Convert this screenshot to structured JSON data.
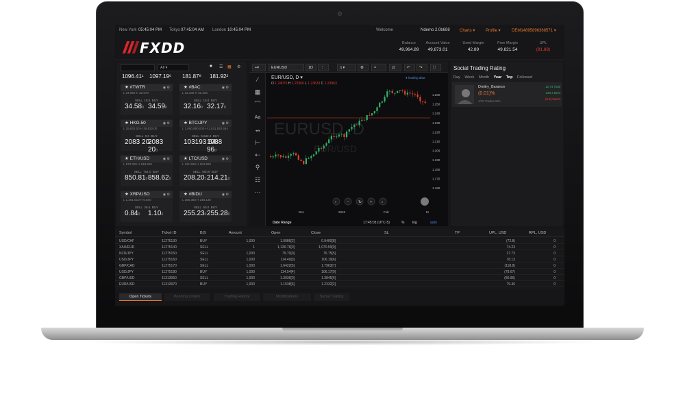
{
  "topbar": {
    "cities": [
      "New York",
      "Tokyo",
      "London"
    ],
    "times": [
      "05:45:04 PM",
      "07:45:04 AM",
      "10:45:04 PM"
    ],
    "welcome": "Welcome",
    "user": "Ndemo 2.0b688",
    "charts": "Charts ▾",
    "profile": "Profile ▾",
    "account": "DEM14895896368571 ▾"
  },
  "brand": {
    "logo": "FXDD"
  },
  "account_stats": [
    {
      "label": "Balance",
      "value": "49,964.89"
    },
    {
      "label": "Account Value",
      "value": "49,873.01"
    },
    {
      "label": "Used Margin",
      "value": "42.89"
    },
    {
      "label": "Free Margin",
      "value": "49,821.54"
    },
    {
      "label": "UPL",
      "value": "(91.88)"
    }
  ],
  "watchlist": {
    "filter": "All ▾",
    "top_row": [
      "1096.41¹",
      "1097.19⁶",
      "181.87⁸",
      "181.92²"
    ],
    "tiles": [
      {
        "symbol": "#TWTR",
        "low": "L 34.950",
        "high": "H 32.570",
        "sell_spread": "SELL",
        "spread": "10.0",
        "buy": "BUY",
        "sell_px": "34.58",
        "sell_sup": "0",
        "buy_px": "34.59",
        "buy_sup": "0"
      },
      {
        "symbol": "#BAC",
        "low": "L 32.230",
        "high": "H 32.330",
        "sell_spread": "SELL",
        "spread": "10.0",
        "buy": "BUY",
        "sell_px": "32.16",
        "sell_sup": "0",
        "buy_px": "32.17",
        "buy_sup": "0"
      },
      {
        "symbol": "HKG.50",
        "low": "L 29,832.00",
        "high": "H 29,832.00",
        "sell_spread": "SELL",
        "spread": "0.0",
        "buy": "BUY",
        "sell_px": "2083 20",
        "sell_sup": "0",
        "buy_px": "2083 20",
        "buy_sup": "0"
      },
      {
        "symbol": "BTC/JPY",
        "low": "L 1,060,950.000",
        "high": "H 1,031,933.644",
        "sell_spread": "SELL",
        "spread": "5,542.4",
        "buy": "BUY",
        "sell_px": "103193 64",
        "sell_sup": "0",
        "buy_px": "1088 96",
        "buy_sup": "0"
      },
      {
        "symbol": "ETH/USD",
        "low": "L 873.000",
        "high": "H 948.520",
        "sell_spread": "SELL",
        "spread": "701.0",
        "buy": "BUY",
        "sell_px": "850.81",
        "sell_sup": "0",
        "buy_px": "858.62",
        "buy_sup": "0"
      },
      {
        "symbol": "LTC/USD",
        "low": "L 221.500",
        "high": "H 204.800",
        "sell_spread": "SELL",
        "spread": "600.9",
        "buy": "BUY",
        "sell_px": "208.20",
        "sell_sup": "1",
        "buy_px": "214.21",
        "buy_sup": "0"
      },
      {
        "symbol": "XRP/USD",
        "low": "L 1,301.510",
        "high": "H 0.840",
        "sell_spread": "SELL",
        "spread": "26.6",
        "buy": "BUY",
        "sell_px": "0.84",
        "sell_sup": "0",
        "buy_px": "1.10",
        "buy_sup": "6"
      },
      {
        "symbol": "#BIDU",
        "low": "L 256.350",
        "high": "H 248.130",
        "sell_spread": "SELL",
        "spread": "50.0",
        "buy": "BUY",
        "sell_px": "255.23",
        "sell_sup": "0",
        "buy_px": "255.28",
        "buy_sup": "0"
      }
    ]
  },
  "chart": {
    "symbol_box": "EURUSD",
    "interval": "1D",
    "title": "EUR/USD, D ▾",
    "ohlc": {
      "o": "1.24075",
      "h": "1.25366",
      "l": "1.23633",
      "c": "1.23963"
    },
    "leading": "● leading data",
    "watermark": "EURUSD, D",
    "watermark_sub": "EUR/USD",
    "x_ticks": [
      "Dec",
      "2018",
      "Feb",
      "M"
    ],
    "y_ticks": [
      "1.260",
      "1.250",
      "1.240",
      "1.230",
      "1.220",
      "1.210",
      "1.200",
      "1.190",
      "1.180",
      "1.170",
      "1.160"
    ],
    "price_labels": [
      "1.25",
      "1.24",
      "1.23"
    ],
    "footer": {
      "range": "Date Range",
      "time": "17:45:03 (UTC-5)",
      "pct": "%",
      "log": "log",
      "auto": "auto"
    },
    "colors": {
      "up": "#2fb36a",
      "down": "#e2412e",
      "line": "#e2412e"
    }
  },
  "social": {
    "title": "Social Trading Rating",
    "tabs": [
      "Day",
      "Week",
      "Month",
      "Year",
      "Top",
      "Followed"
    ],
    "active_tab": "Year",
    "trader": {
      "name": "Dmitry_Baranov",
      "pct": "(0.01)%",
      "trades": "1/15 Trades Win",
      "r1": "12.74 Total",
      "r2": "128.4 Best",
      "r3": "(5.8) Worst"
    }
  },
  "table": {
    "headers": [
      "Symbol",
      "Ticket ID",
      "B|S",
      "Amount",
      "Open",
      "Close",
      "SL",
      "TP",
      "UPL, USD",
      "RPL, USD"
    ],
    "rows": [
      [
        "USD/CHF",
        "11275130",
        "BUY",
        "1,000",
        "1.0086[2]",
        "0.9400[8]",
        "",
        "",
        "(72.8)",
        "0"
      ],
      [
        "XAU/EUR",
        "11275140",
        "SELL",
        "1",
        "1,130.76[0]",
        "1,070.59[0]",
        "",
        "",
        "74.23",
        "0"
      ],
      [
        "NZD/JPY",
        "11275150",
        "SELL",
        "1,000",
        "79.70[0]",
        "76.75[5]",
        "",
        "",
        "27.73",
        "0"
      ],
      [
        "USD/JPY",
        "11275160",
        "SELL",
        "1,000",
        "114.49[3]",
        "106.19[6]",
        "",
        "",
        "78.13",
        "0"
      ],
      [
        "GBP/CAD",
        "11275170",
        "SELL",
        "1,000",
        "1.6422[5]",
        "1.7963[7]",
        "",
        "",
        "(118.8)",
        "0"
      ],
      [
        "USD/JPY",
        "11275180",
        "BUY",
        "1,000",
        "114.54[4]",
        "106.17[0]",
        "",
        "",
        "(78.67)",
        "0"
      ],
      [
        "GBP/USD",
        "11313050",
        "SELL",
        "1,000",
        "1.3036[0]",
        "1.3845[6]",
        "",
        "",
        "(80.96)",
        "0"
      ],
      [
        "EUR/USD",
        "11313970",
        "BUY",
        "1,000",
        "1.1538[6]",
        "1.2332[2]",
        "",
        "",
        "79.46",
        "0"
      ]
    ]
  },
  "bottom_tabs": [
    "Open Tickets",
    "Pending Orders",
    "Trading History",
    "Modifications",
    "Social Trading"
  ]
}
